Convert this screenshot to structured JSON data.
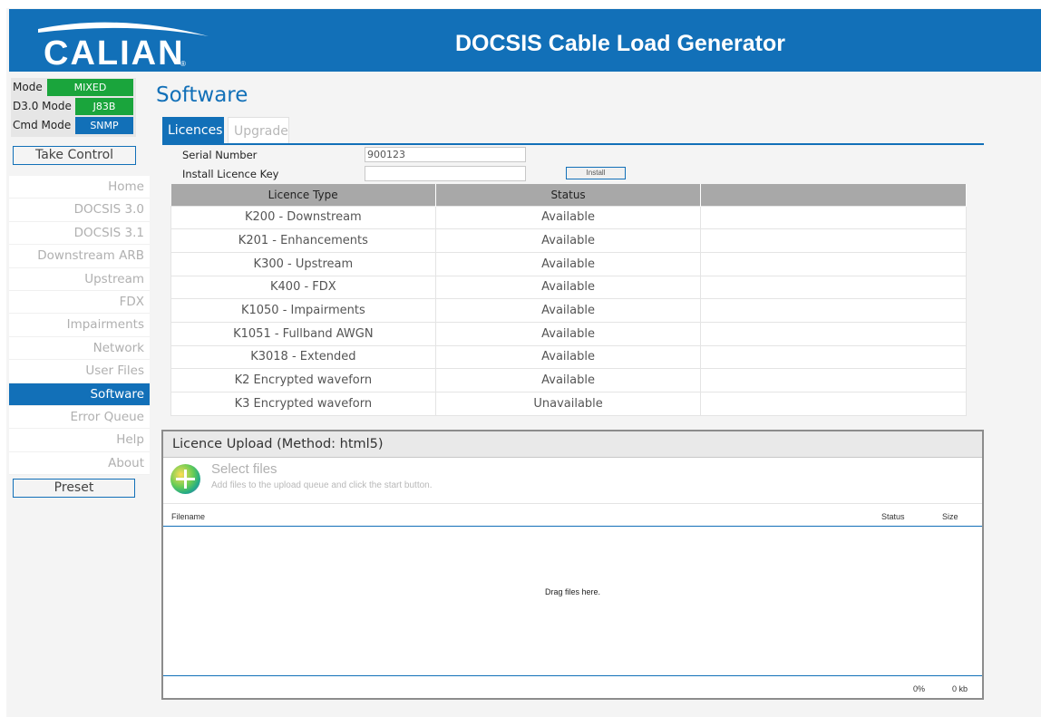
{
  "header": {
    "logo_text": "CALIAN",
    "logo_reg": "®",
    "title": "DOCSIS Cable Load Generator"
  },
  "modes": [
    {
      "label": "Mode",
      "value": "MIXED",
      "color": "#1aa53c"
    },
    {
      "label": "D3.0 Mode",
      "value": "J83B",
      "color": "#1aa53c"
    },
    {
      "label": "Cmd Mode",
      "value": "SNMP",
      "color": "#1270b8"
    }
  ],
  "sidebar": {
    "take_control": "Take Control",
    "items": [
      {
        "label": "Home"
      },
      {
        "label": "DOCSIS 3.0"
      },
      {
        "label": "DOCSIS 3.1"
      },
      {
        "label": "Downstream ARB"
      },
      {
        "label": "Upstream"
      },
      {
        "label": "FDX"
      },
      {
        "label": "Impairments"
      },
      {
        "label": "Network"
      },
      {
        "label": "User Files"
      },
      {
        "label": "Software",
        "active": true
      },
      {
        "label": "Error Queue"
      },
      {
        "label": "Help"
      },
      {
        "label": "About"
      }
    ],
    "preset": "Preset"
  },
  "main": {
    "title": "Software",
    "tabs": [
      {
        "label": "Licences"
      },
      {
        "label": "Upgrade"
      }
    ],
    "serial_label": "Serial Number",
    "serial_value": "900123",
    "install_key_label": "Install Licence Key",
    "install_key_value": "",
    "install_button": "Install",
    "table": {
      "headers": [
        "Licence Type",
        "Status",
        ""
      ],
      "rows": [
        [
          "K200 - Downstream",
          "Available",
          ""
        ],
        [
          "K201 - Enhancements",
          "Available",
          ""
        ],
        [
          "K300 - Upstream",
          "Available",
          ""
        ],
        [
          "K400 - FDX",
          "Available",
          ""
        ],
        [
          "K1050 - Impairments",
          "Available",
          ""
        ],
        [
          "K1051 - Fullband AWGN",
          "Available",
          ""
        ],
        [
          "K3018 - Extended",
          "Available",
          ""
        ],
        [
          "K2 Encrypted waveforn",
          "Available",
          ""
        ],
        [
          "K3 Encrypted waveforn",
          "Unavailable",
          ""
        ]
      ]
    },
    "upload": {
      "title": "Licence Upload (Method: html5)",
      "select_title": "Select files",
      "select_sub": "Add files to the upload queue and click the start button.",
      "col_filename": "Filename",
      "col_status": "Status",
      "col_size": "Size",
      "drag_text": "Drag files here.",
      "total_percent": "0%",
      "total_size": "0 kb"
    }
  }
}
